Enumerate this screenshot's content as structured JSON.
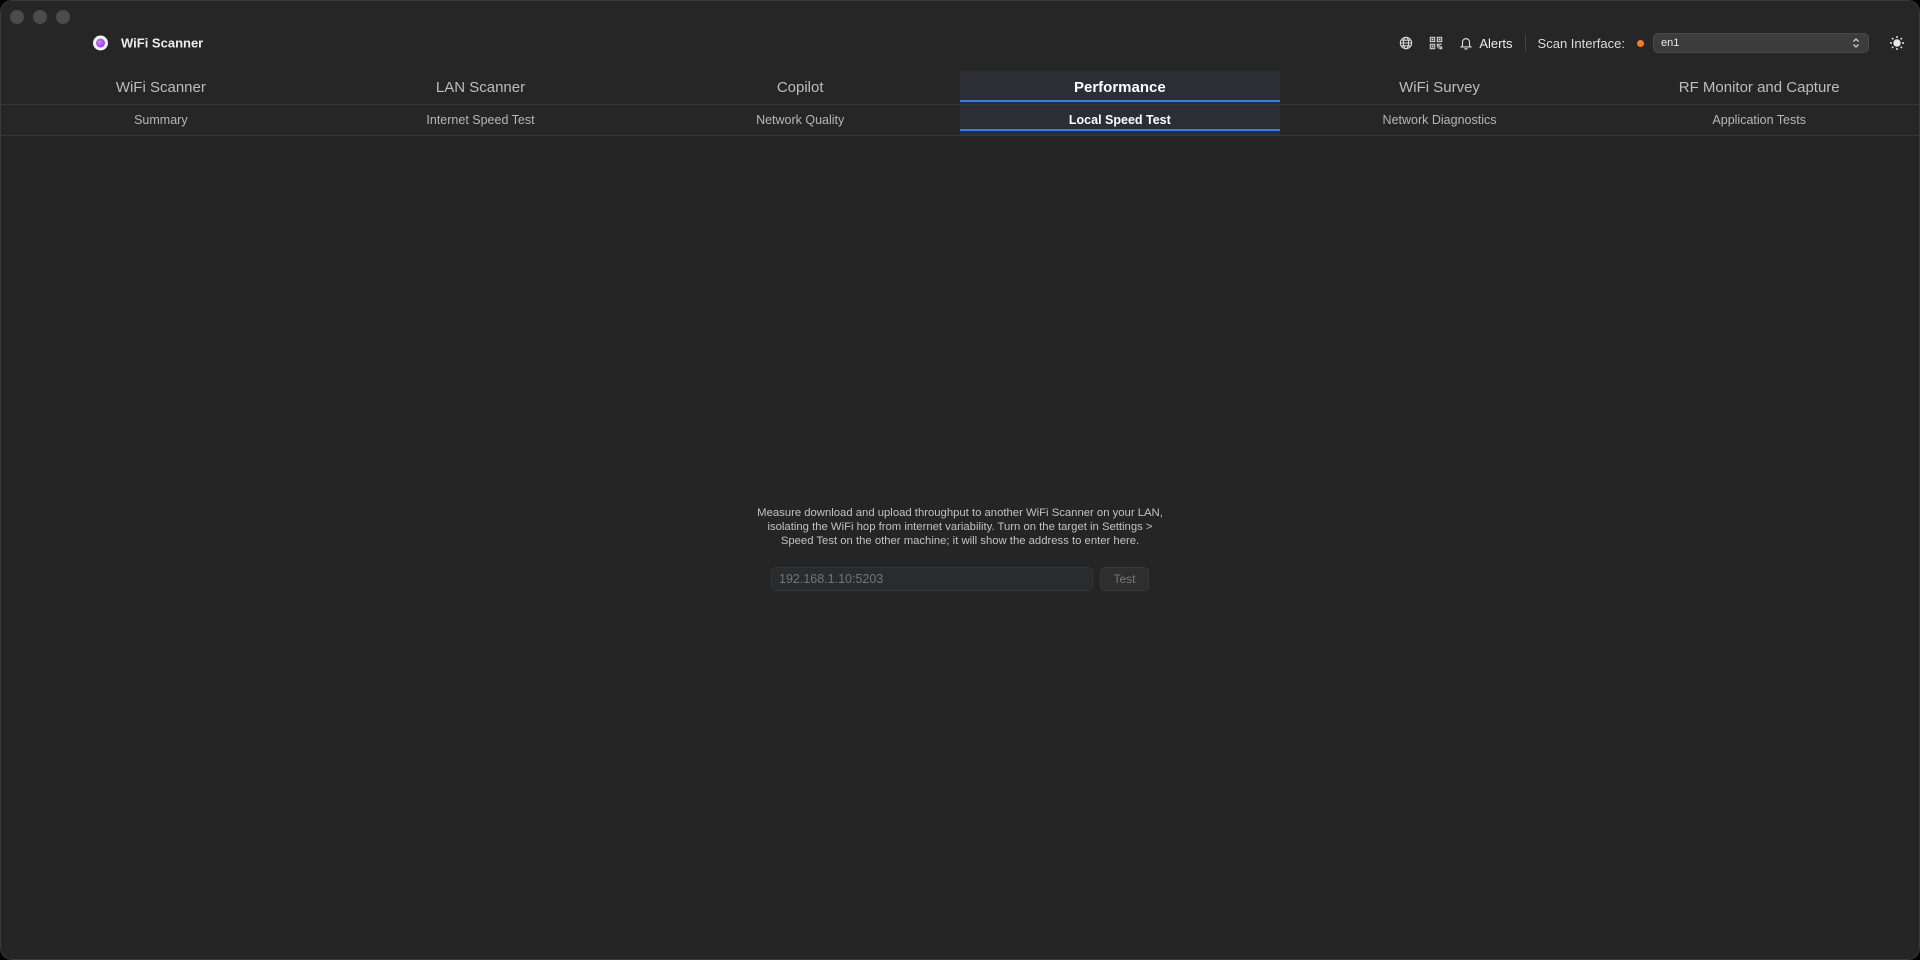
{
  "app": {
    "title": "WiFi Scanner"
  },
  "toolbar": {
    "alerts_label": "Alerts",
    "scan_interface_label": "Scan Interface:",
    "interface_value": "en1",
    "status_color": "#ff7a1a"
  },
  "main_tabs": [
    {
      "label": "WiFi Scanner",
      "active": false
    },
    {
      "label": "LAN Scanner",
      "active": false
    },
    {
      "label": "Copilot",
      "active": false
    },
    {
      "label": "Performance",
      "active": true
    },
    {
      "label": "WiFi Survey",
      "active": false
    },
    {
      "label": "RF Monitor and Capture",
      "active": false
    }
  ],
  "sub_tabs": [
    {
      "label": "Summary",
      "active": false
    },
    {
      "label": "Internet Speed Test",
      "active": false
    },
    {
      "label": "Network Quality",
      "active": false
    },
    {
      "label": "Local Speed Test",
      "active": true
    },
    {
      "label": "Network Diagnostics",
      "active": false
    },
    {
      "label": "Application Tests",
      "active": false
    }
  ],
  "local_speed_test": {
    "description_lines": [
      "Measure download and upload throughput to another WiFi Scanner on your LAN,",
      "isolating the WiFi hop from internet variability. Turn on the target in Settings >",
      "Speed Test on the other machine; it will show the address to enter here."
    ],
    "address_placeholder": "192.168.1.10:5203",
    "address_value": "",
    "test_button_label": "Test"
  },
  "accent_color": "#2f7cf6"
}
